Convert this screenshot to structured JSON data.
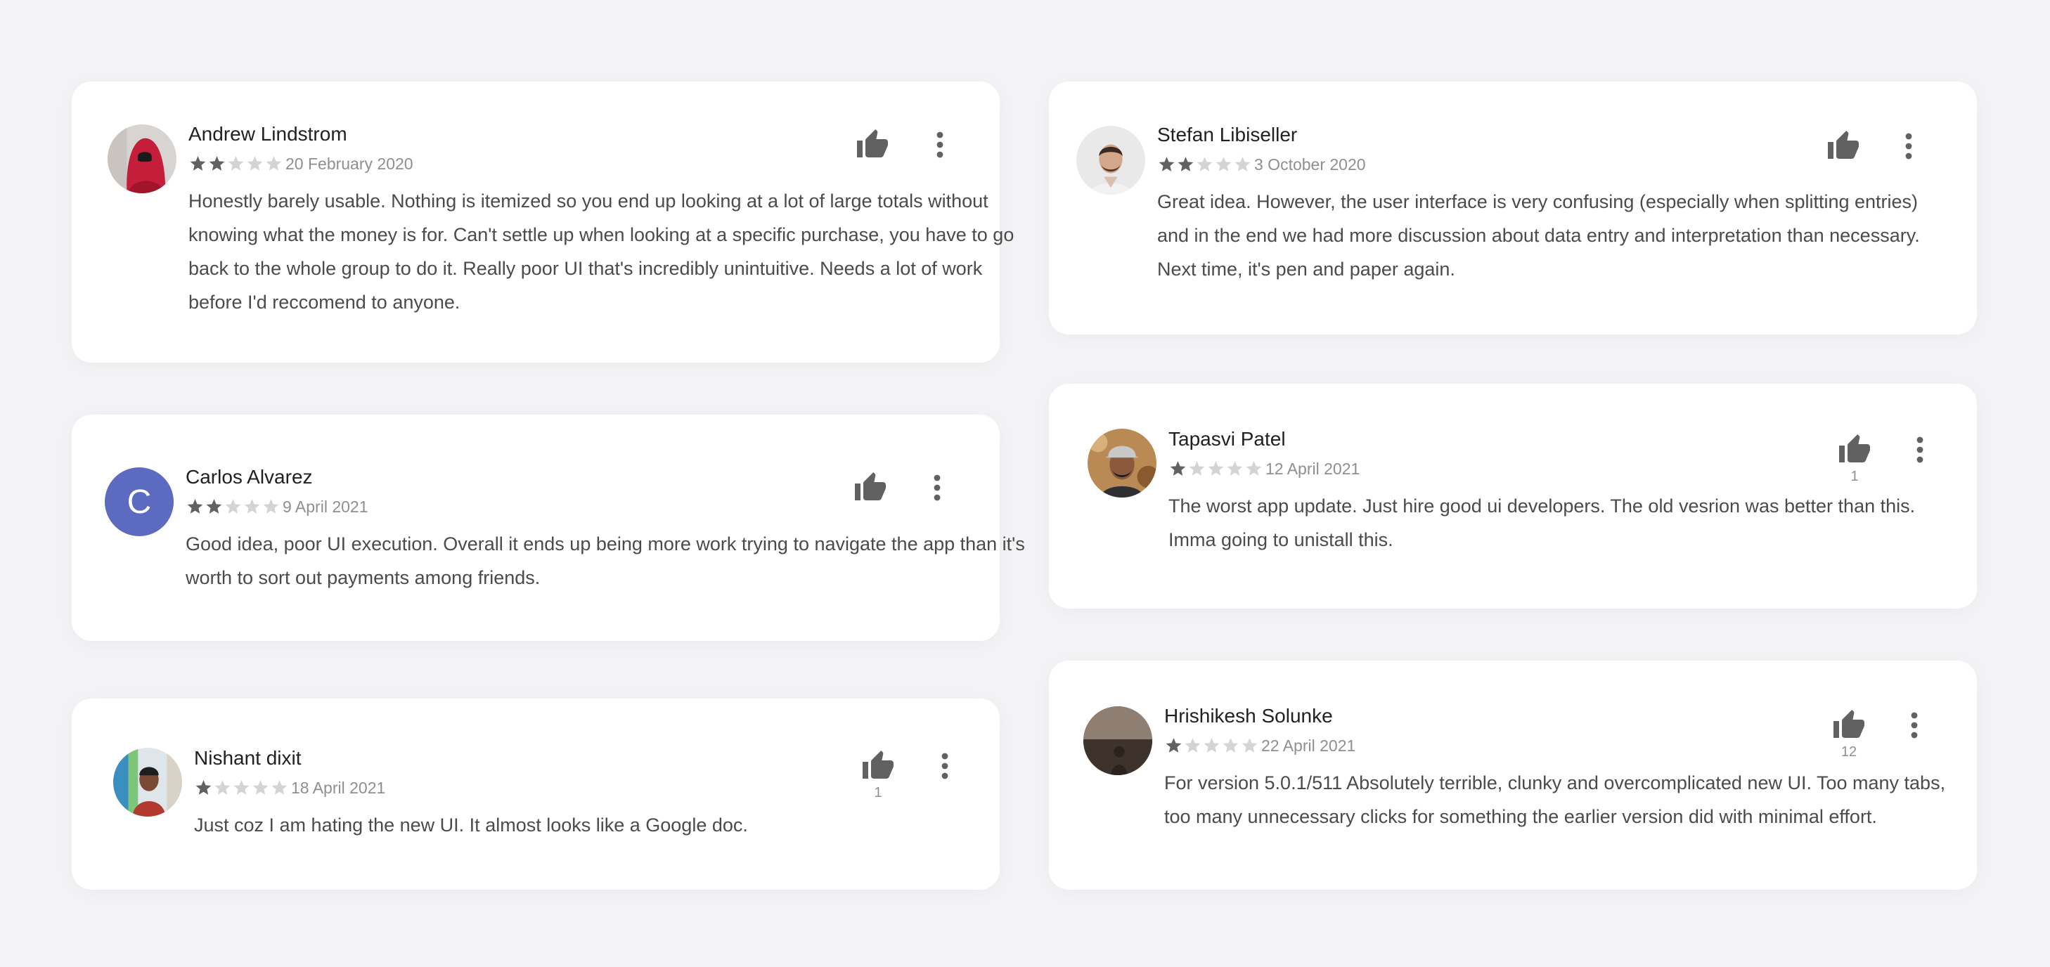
{
  "colors": {
    "background": "#f3f3f5",
    "card": "#ffffff",
    "star_filled": "#616161",
    "star_empty": "#d4d4d4",
    "icon": "#616161"
  },
  "icons": {
    "like": "thumb-up-icon",
    "more": "more-vert-icon",
    "star": "star-icon"
  },
  "reviews": [
    {
      "author": "Andrew Lindstrom",
      "rating": 2,
      "date": "20 February 2020",
      "text": "Honestly barely usable. Nothing is itemized so you end up looking at a lot of large totals without knowing what the money is for. Can't settle up when looking at a specific purchase, you have to go back to the whole group to do it. Really poor UI that's incredibly unintuitive. Needs a lot of work before I'd reccomend to anyone.",
      "likes": ""
    },
    {
      "author": "Stefan Libiseller",
      "rating": 2,
      "date": "3 October 2020",
      "text": "Great idea. However, the user interface is very confusing (especially when splitting entries) and in the end we had more discussion about data entry and interpretation than necessary. Next time, it's pen and paper again.",
      "likes": ""
    },
    {
      "author": "Carlos Alvarez",
      "avatar_letter": "C",
      "rating": 2,
      "date": "9 April 2021",
      "text": "Good idea, poor UI execution. Overall it ends up being more work trying to navigate the app than it's worth to sort out payments among friends.",
      "likes": ""
    },
    {
      "author": "Tapasvi Patel",
      "rating": 1,
      "date": "12 April 2021",
      "text": "The worst app update. Just hire good ui developers. The old vesrion was better than this. Imma going to unistall this.",
      "likes": "1"
    },
    {
      "author": "Nishant dixit",
      "rating": 1,
      "date": "18 April 2021",
      "text": "Just coz I am hating the new UI. It almost looks like a Google doc.",
      "likes": "1"
    },
    {
      "author": "Hrishikesh Solunke",
      "rating": 1,
      "date": "22 April 2021",
      "text": "For version 5.0.1/511 Absolutely terrible, clunky and overcomplicated new UI. Too many tabs, too many unnecessary clicks for something the earlier version did with minimal effort.",
      "likes": "12"
    }
  ]
}
